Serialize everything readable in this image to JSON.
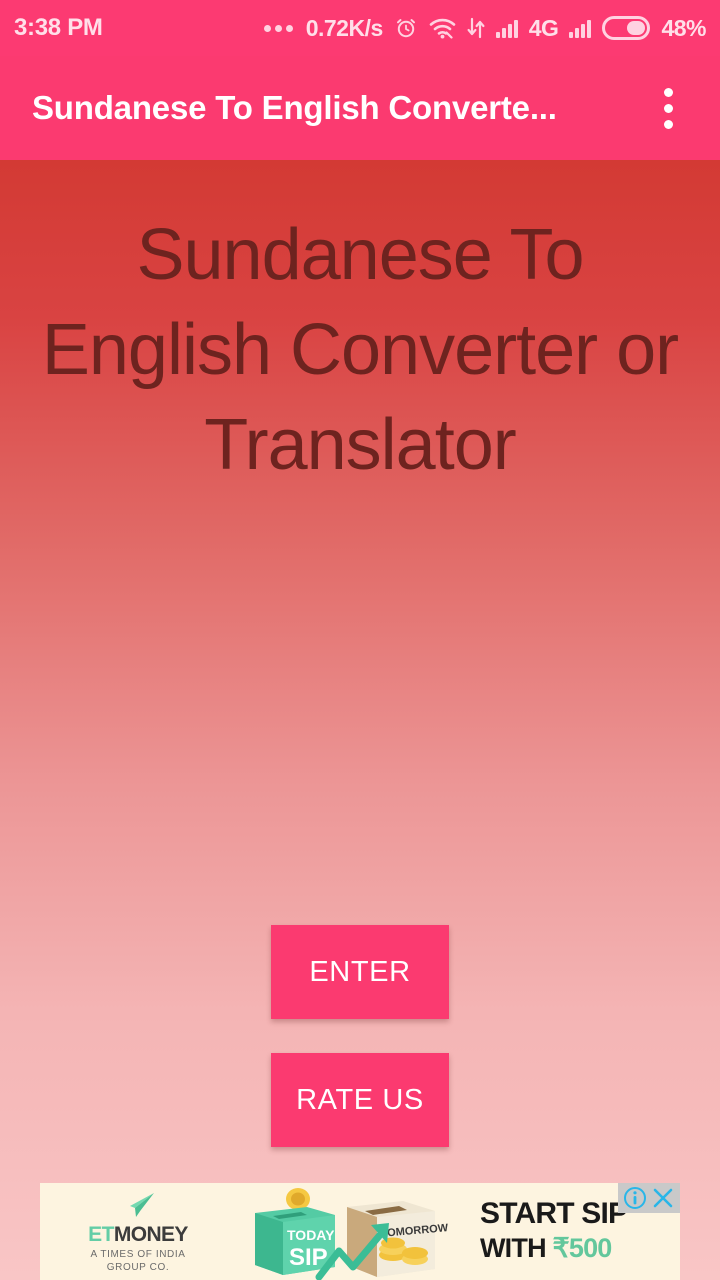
{
  "status_bar": {
    "time": "3:38 PM",
    "net_speed": "0.72K/s",
    "network_type": "4G",
    "battery_percent": "48%",
    "background_color": "#fc3a72",
    "icons": [
      "more-dots-icon",
      "alarm-clock-icon",
      "wifi-icon",
      "data-transfer-icon",
      "signal-bars-icon",
      "signal-bars-icon-2",
      "battery-icon"
    ]
  },
  "app_bar": {
    "title": "Sundanese To English Converte...",
    "overflow_label": "more-options",
    "background_color": "#fb3a70"
  },
  "main": {
    "headline_lines": [
      "Sundanese To",
      "English Converter or",
      "Translator"
    ],
    "headline_color": "#6e231f",
    "gradient_top": "#d33a34",
    "gradient_bottom": "#f9c6c6",
    "buttons": [
      {
        "label": "ENTER",
        "name": "enter-button",
        "color": "#fb3a70"
      },
      {
        "label": "RATE US",
        "name": "rate-us-button",
        "color": "#fb3a70"
      }
    ]
  },
  "ad": {
    "brand_et": "ET",
    "brand_money": "MONEY",
    "subtitle_line1": "A TIMES OF INDIA",
    "subtitle_line2": "GROUP CO.",
    "art_today_label": "TODAY",
    "art_sip_label": "SIP",
    "art_tomorrow_label": "TOMORROW",
    "copy_line1": "START SIP",
    "copy_line2_prefix": "WITH ",
    "copy_line2_amount": "₹500",
    "background_color": "#fdf4e0",
    "accent_color": "#63cda6",
    "choices_info_icon": "ad-info-icon",
    "choices_close_icon": "ad-close-icon"
  }
}
